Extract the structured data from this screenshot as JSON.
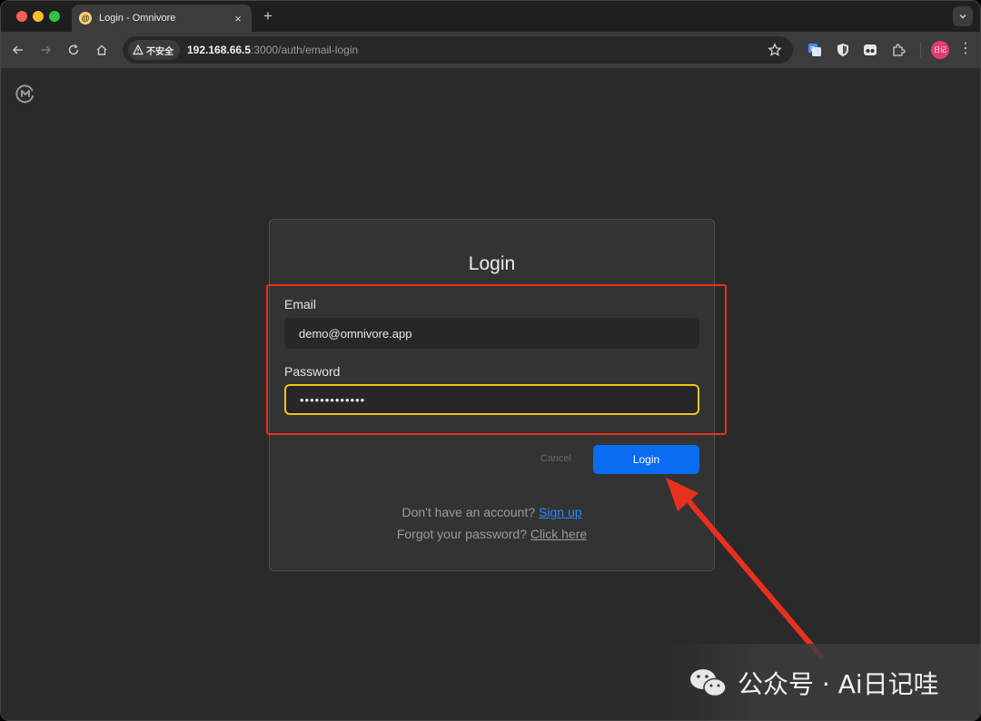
{
  "browser": {
    "tab_title": "Login - Omnivore",
    "new_tab_symbol": "+",
    "close_symbol": "×",
    "security_label": "不安全",
    "url_host": "192.168.66.5",
    "url_rest": ":3000/auth/email-login",
    "profile_label": "日记",
    "menu_symbol": "⋮"
  },
  "page": {
    "title": "Login",
    "email_label": "Email",
    "email_value": "demo@omnivore.app",
    "password_label": "Password",
    "password_mask": "•••••••••••••",
    "cancel_label": "Cancel",
    "login_label": "Login",
    "signup_prompt": "Don't have an account? ",
    "signup_link": "Sign up",
    "forgot_prompt": "Forgot your password? ",
    "forgot_link": "Click here"
  },
  "watermark": {
    "text": "公众号 · Ai日记哇"
  },
  "colors": {
    "primary_button": "#0a6cf0",
    "focus_border": "#f0c419",
    "annotation_red": "#e8311d",
    "link_blue": "#2e86ff"
  }
}
